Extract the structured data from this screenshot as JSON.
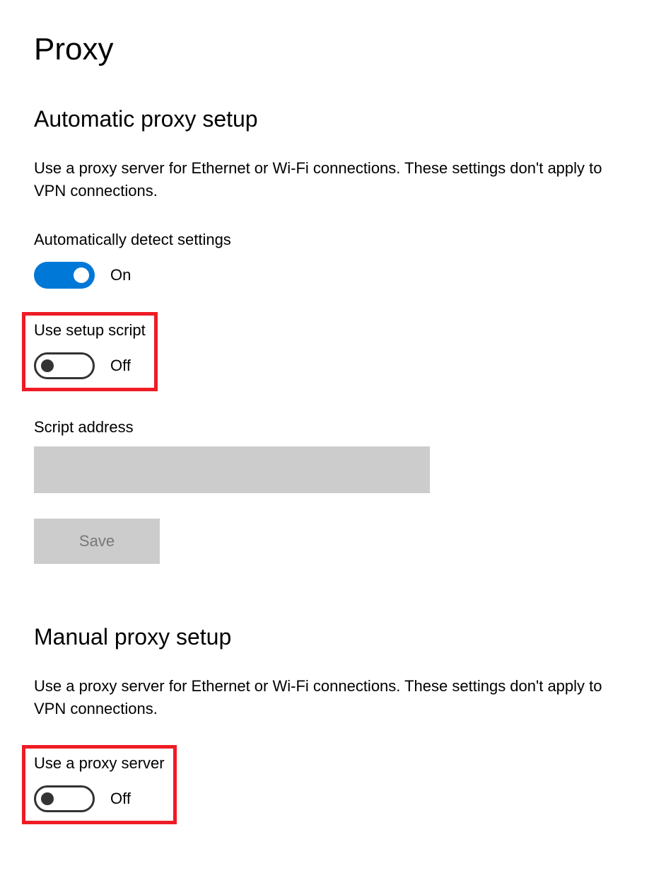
{
  "page": {
    "title": "Proxy"
  },
  "automatic": {
    "heading": "Automatic proxy setup",
    "description": "Use a proxy server for Ethernet or Wi-Fi connections. These settings don't apply to VPN connections.",
    "detect": {
      "label": "Automatically detect settings",
      "on": true,
      "state_label": "On"
    },
    "script": {
      "label": "Use setup script",
      "on": false,
      "state_label": "Off"
    },
    "address": {
      "label": "Script address",
      "value": ""
    },
    "save_label": "Save"
  },
  "manual": {
    "heading": "Manual proxy setup",
    "description": "Use a proxy server for Ethernet or Wi-Fi connections. These settings don't apply to VPN connections.",
    "use_proxy": {
      "label": "Use a proxy server",
      "on": false,
      "state_label": "Off"
    }
  }
}
